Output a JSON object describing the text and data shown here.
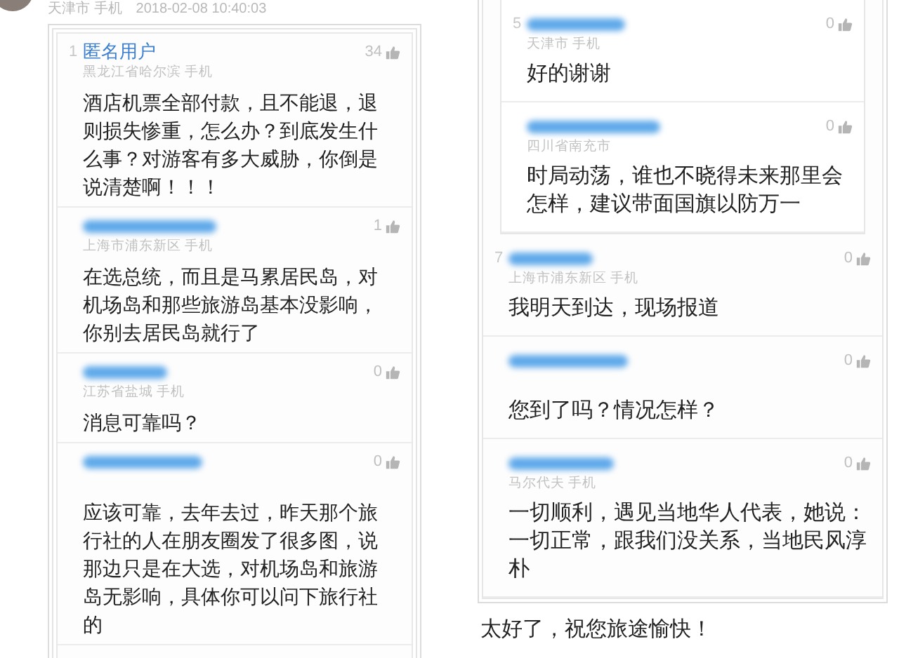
{
  "header": {
    "location": "天津市 手机",
    "time": "2018-02-08 10:40:03"
  },
  "left_comments": [
    {
      "index": "1",
      "name": "匿名用户",
      "likes": "34",
      "location": "黑龙江省哈尔滨 手机",
      "text": "酒店机票全部付款，且不能退，退则损失惨重，怎么办？到底发生什么事？对游客有多大威胁，你倒是说清楚啊！！！"
    },
    {
      "likes": "1",
      "location": "上海市浦东新区 手机",
      "text": "在选总统，而且是马累居民岛，对机场岛和那些旅游岛基本没影响，你别去居民岛就行了"
    },
    {
      "likes": "0",
      "location": "江苏省盐城 手机",
      "text": "消息可靠吗？"
    },
    {
      "likes": "0",
      "text": "应该可靠，去年去过，昨天那个旅行社的人在朋友圈发了很多图，说那边只是在大选，对机场岛和旅游岛无影响，具体你可以问下旅行社的"
    }
  ],
  "right_comments": [
    {
      "index": "5",
      "likes": "0",
      "location": "天津市 手机",
      "text": "好的谢谢"
    },
    {
      "likes": "0",
      "location": "四川省南充市",
      "text": "时局动荡，谁也不晓得未来那里会怎样，建议带面国旗以防万一"
    },
    {
      "index": "7",
      "likes": "0",
      "location": "上海市浦东新区 手机",
      "text": "我明天到达，现场报道"
    },
    {
      "likes": "0",
      "text": "您到了吗？情况怎样？"
    },
    {
      "likes": "0",
      "location": "马尔代夫 手机",
      "text": "一切顺利，遇见当地华人代表，她说：一切正常，跟我们没关系，当地民风淳朴"
    }
  ],
  "footer_reply": "太好了，祝您旅途愉快！"
}
